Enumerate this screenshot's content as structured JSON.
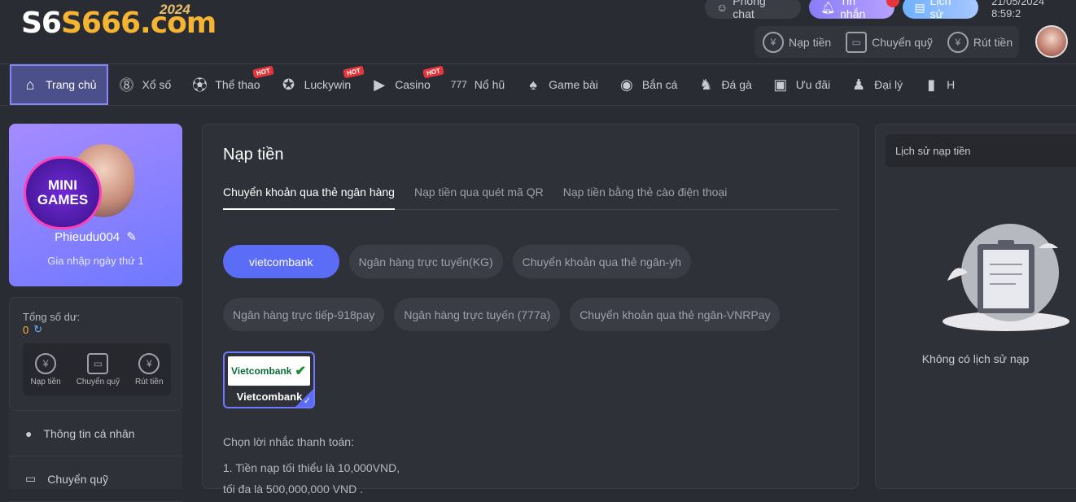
{
  "brand": {
    "logo_s6": "S6",
    "logo_666": "S666.com",
    "logo_year": "2024"
  },
  "topbar": {
    "phong_chat": "Phòng chat",
    "tin_nhan": "Tin nhắn",
    "lich_su": "Lịch sử",
    "datetime": "21/05/2024 8:59:2",
    "actions": [
      {
        "label": "Nạp tiền",
        "icon": "deposit-icon"
      },
      {
        "label": "Chuyển quỹ",
        "icon": "wallet-icon"
      },
      {
        "label": "Rút tiền",
        "icon": "withdraw-icon"
      }
    ]
  },
  "nav": [
    {
      "label": "Trang chủ",
      "icon": "home-icon",
      "hot": false
    },
    {
      "label": "Xổ số",
      "icon": "lottery-icon",
      "hot": false
    },
    {
      "label": "Thể thao",
      "icon": "sports-icon",
      "hot": true
    },
    {
      "label": "Luckywin",
      "icon": "luckywin-icon",
      "hot": true
    },
    {
      "label": "Casino",
      "icon": "casino-icon",
      "hot": true
    },
    {
      "label": "Nổ hũ",
      "icon": "slots-icon",
      "hot": false
    },
    {
      "label": "Game bài",
      "icon": "cards-icon",
      "hot": false
    },
    {
      "label": "Bắn cá",
      "icon": "fish-icon",
      "hot": false
    },
    {
      "label": "Đá gà",
      "icon": "rooster-icon",
      "hot": false
    },
    {
      "label": "Ưu đãi",
      "icon": "gift-icon",
      "hot": false
    },
    {
      "label": "Đại lý",
      "icon": "agent-icon",
      "hot": false
    },
    {
      "label": "H",
      "icon": "book-icon",
      "hot": false
    }
  ],
  "hot_label": "HOT",
  "profile": {
    "minigames_line1": "MINI",
    "minigames_line2": "GAMES",
    "username": "Phieudu004",
    "join_text": "Gia nhập ngày thứ 1"
  },
  "balance": {
    "label": "Tổng số dư:",
    "value": "0",
    "actions": [
      "Nạp tiền",
      "Chuyển quỹ",
      "Rút tiền"
    ]
  },
  "side_menu": [
    "Thông tin cá nhân",
    "Chuyển quỹ"
  ],
  "main": {
    "title": "Nạp tiền",
    "tabs": [
      "Chuyển khoản qua thẻ ngân hàng",
      "Nạp tiền qua quét mã QR",
      "Nạp tiền bằng thẻ cào điện thoại"
    ],
    "bank_row1": [
      "vietcombank",
      "Ngân hàng trực tuyến(KG)",
      "Chuyển khoản qua thẻ ngân-yh"
    ],
    "bank_row2": [
      "Ngân hàng trực tiếp-918pay",
      "Ngân hàng trực tuyến  (777a)",
      "Chuyển khoản qua thẻ ngân-VNRPay"
    ],
    "bank_card_logo": "Vietcombank",
    "bank_card_name": "Vietcombank",
    "notes_title": "Chọn lời nhắc thanh toán:",
    "note1": "1. Tiền nạp tối thiểu là 10,000VND,",
    "note2": "tối đa là 500,000,000 VND ."
  },
  "history": {
    "title": "Lịch sử nạp tiền",
    "empty": "Không có lịch sử nạp"
  }
}
